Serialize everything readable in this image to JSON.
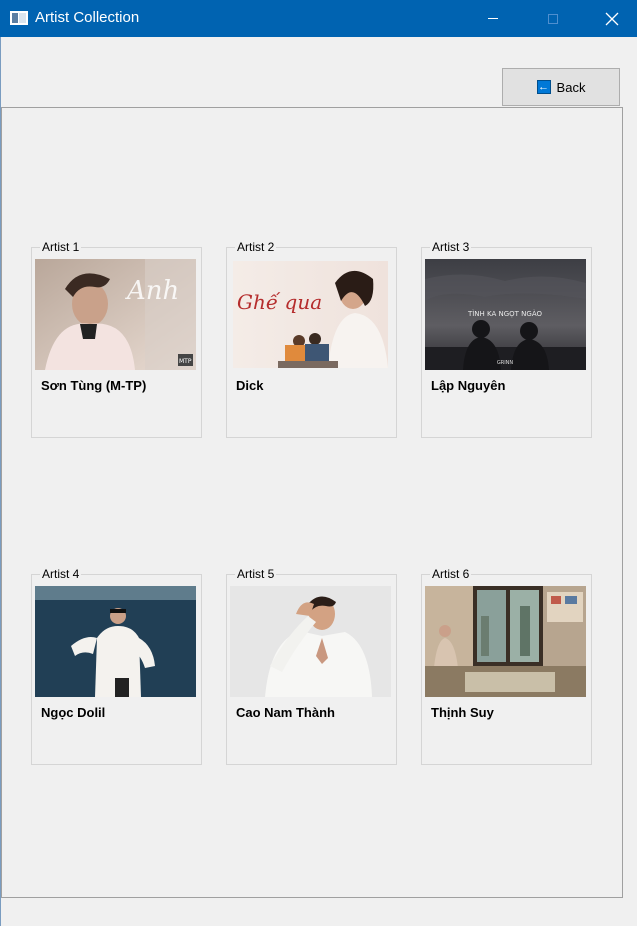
{
  "window": {
    "title": "Artist Collection"
  },
  "toolbar": {
    "back_label": "Back",
    "back_icon": "back-arrow-icon"
  },
  "artists": [
    {
      "legend": "Artist 1",
      "name": "Sơn Tùng (M-TP)",
      "photo_overlay": "Anh",
      "badge": "MTP"
    },
    {
      "legend": "Artist 2",
      "name": "Dick",
      "photo_overlay": "Ghế qua"
    },
    {
      "legend": "Artist 3",
      "name": "Lập Nguyên",
      "photo_overlay": "TÌNH KA NGỌT NGÀO",
      "badge": "GRINN"
    },
    {
      "legend": "Artist 4",
      "name": "Ngọc Dolil"
    },
    {
      "legend": "Artist 5",
      "name": "Cao Nam Thành"
    },
    {
      "legend": "Artist 6",
      "name": "Thịnh Suy"
    }
  ],
  "colors": {
    "titlebar": "#0063b1",
    "window_bg": "#f0f0f0",
    "accent": "#0078d7"
  }
}
